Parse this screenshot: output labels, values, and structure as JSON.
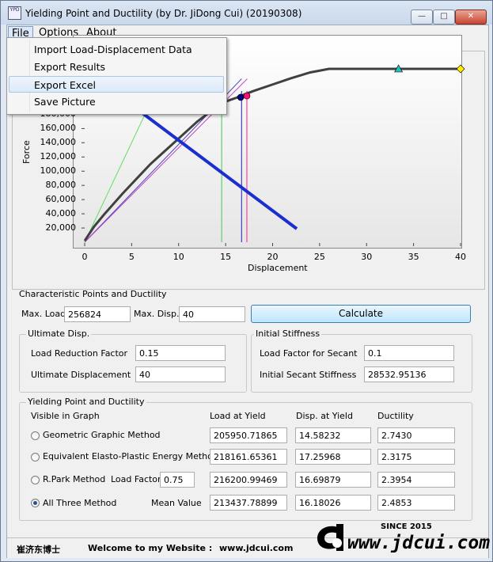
{
  "window": {
    "title": "Yielding Point and Ductility (by Dr. JiDong Cui) (20190308)",
    "icon_text": "YPD"
  },
  "menubar": {
    "file": "File",
    "options": "Options",
    "about": "About"
  },
  "file_menu": {
    "items": [
      "Import Load-Displacement Data",
      "Export Results",
      "Export Excel",
      "Save Picture"
    ],
    "highlighted": "Export Excel"
  },
  "chart_data": {
    "type": "line",
    "xlabel": "Displacement",
    "ylabel": "Force",
    "xlim": [
      0,
      40
    ],
    "x_ticks": [
      "0",
      "5",
      "10",
      "15",
      "20",
      "25",
      "30",
      "35",
      "40"
    ],
    "y_ticks": [
      "20,000",
      "40,000",
      "60,000",
      "80,000",
      "100,000",
      "120,000",
      "140,000",
      "160,000",
      "180,000"
    ],
    "series": [
      {
        "name": "",
        "color": "#404040",
        "x": [
          0,
          1,
          2,
          3,
          4,
          5,
          6,
          7,
          8,
          9,
          10,
          11,
          12,
          13,
          14,
          15,
          16.5,
          17,
          18,
          20,
          22,
          24,
          26,
          28,
          30,
          32,
          33.4,
          36,
          38,
          40
        ],
        "y": [
          2000,
          22000,
          38000,
          53000,
          68000,
          82000,
          96000,
          110000,
          122000,
          134000,
          146000,
          158000,
          170000,
          180000,
          190000,
          198000,
          205000,
          208000,
          213000,
          222000,
          231000,
          239000,
          245000,
          250000,
          253500,
          255500,
          256824,
          256000,
          256000,
          256000
        ]
      }
    ],
    "markers": [
      {
        "type": "circle",
        "color": "#000080",
        "x": 16.6,
        "y": 204000
      },
      {
        "type": "circle",
        "color": "#ff1070",
        "x": 17.26,
        "y": 206000
      },
      {
        "type": "triangle",
        "color": "#20c0c0",
        "x": 33.4,
        "y": 256824
      },
      {
        "type": "diamond",
        "color": "#ffee00",
        "x": 40,
        "y": 256000
      }
    ],
    "vertical_lines": [
      {
        "color": "#60d060",
        "x": 14.58
      },
      {
        "color": "#4040c0",
        "x": 16.7
      },
      {
        "color": "#ff40a0",
        "x": 17.26
      }
    ],
    "diag_lines": [
      {
        "color": "#60e060",
        "x": [
          0,
          8.2
        ],
        "y": [
          0,
          230000
        ]
      },
      {
        "color": "#4040c0",
        "x": [
          0,
          16.7
        ],
        "y": [
          0,
          230000
        ]
      },
      {
        "color": "#c040c0",
        "x": [
          0,
          17.3
        ],
        "y": [
          0,
          230000
        ]
      }
    ],
    "grid": false,
    "legend": "none"
  },
  "characteristic": {
    "title": "Characteristic Points and Ductility",
    "max_load_label": "Max. Load",
    "max_load": "256824",
    "max_disp_label": "Max. Disp.",
    "max_disp": "40",
    "calculate": "Calculate"
  },
  "ultimate": {
    "title": "Ultimate Disp.",
    "factor_label": "Load Reduction Factor",
    "factor": "0.15",
    "disp_label": "Ultimate Displacement",
    "disp": "40"
  },
  "initial": {
    "title": "Initial Stiffness",
    "factor_label": "Load Factor for Secant",
    "factor": "0.1",
    "stiff_label": "Initial Secant Stiffness",
    "stiff": "28532.95136"
  },
  "yielding": {
    "title": "Yielding Point and Ductility",
    "visible_label": "Visible in Graph",
    "col_load": "Load at Yield",
    "col_disp": "Disp. at Yield",
    "col_duct": "Ductility",
    "park_factor_label": "Load Factor",
    "park_factor": "0.75",
    "mean_label": "Mean Value",
    "rows": [
      {
        "label": "Geometric Graphic Method",
        "load": "205950.71865",
        "disp": "14.58232",
        "duct": "2.7430",
        "selected": false
      },
      {
        "label": "Equivalent Elasto-Plastic Energy Method",
        "load": "218161.65361",
        "disp": "17.25968",
        "duct": "2.3175",
        "selected": false
      },
      {
        "label": "R.Park Method",
        "load": "216200.99469",
        "disp": "16.69879",
        "duct": "2.3954",
        "selected": false
      },
      {
        "label": "All Three Method",
        "load": "213437.78899",
        "disp": "16.18026",
        "duct": "2.4853",
        "selected": true
      }
    ]
  },
  "status": {
    "author": "崔济东博士",
    "welcome": "Welcome to my Website :",
    "site": "www.jdcui.com"
  },
  "logo": {
    "since": "SINCE 2015",
    "url": "www.jdcui.com"
  }
}
